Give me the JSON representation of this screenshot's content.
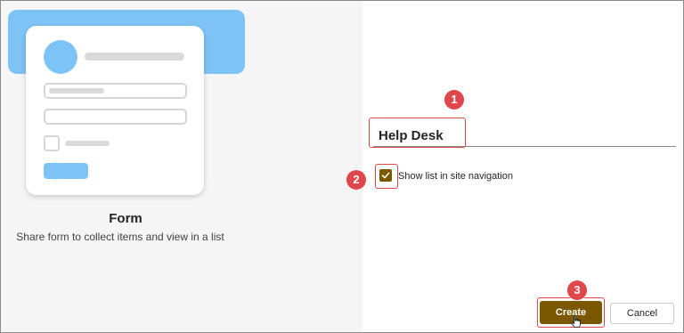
{
  "form_template": {
    "title": "Form",
    "description": "Share form to collect items and view in a list"
  },
  "list_settings": {
    "name_value": "Help Desk",
    "show_in_nav_label": "Show list in site navigation",
    "show_in_nav_checked": true
  },
  "actions": {
    "create_label": "Create",
    "cancel_label": "Cancel"
  },
  "annotations": {
    "step1": "1",
    "step2": "2",
    "step3": "3"
  },
  "colors": {
    "accent": "#7b5800",
    "annotation": "#e0474c",
    "thumbnail_blue": "#7ec3f5"
  },
  "icons": {
    "checkbox": "checkmark-icon",
    "cursor": "hand-cursor-icon"
  }
}
